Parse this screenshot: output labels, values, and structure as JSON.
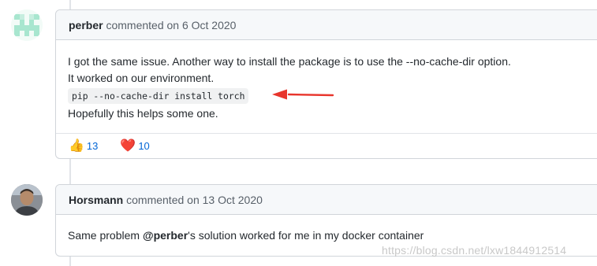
{
  "comments": [
    {
      "author": "perber",
      "meta": "commented on 6 Oct 2020",
      "lines": [
        "I got the same issue. Another way to install the package is to use the --no-cache-dir option.",
        "It worked on our environment."
      ],
      "code": "pip --no-cache-dir install torch",
      "after": "Hopefully this helps some one.",
      "reactions": [
        {
          "emoji": "👍",
          "count": "13",
          "icon": "thumbs-up-icon"
        },
        {
          "emoji": "❤️",
          "count": "10",
          "icon": "heart-icon"
        }
      ]
    },
    {
      "author": "Horsmann",
      "meta": "commented on 13 Oct 2020",
      "body_prefix": "Same problem ",
      "mention": "@perber",
      "body_suffix": "'s solution worked for me in my docker container"
    }
  ],
  "annotation": {
    "color": "#e8352c",
    "icon": "red-arrow-icon"
  },
  "watermark": "https://blog.csdn.net/lxw1844912514"
}
